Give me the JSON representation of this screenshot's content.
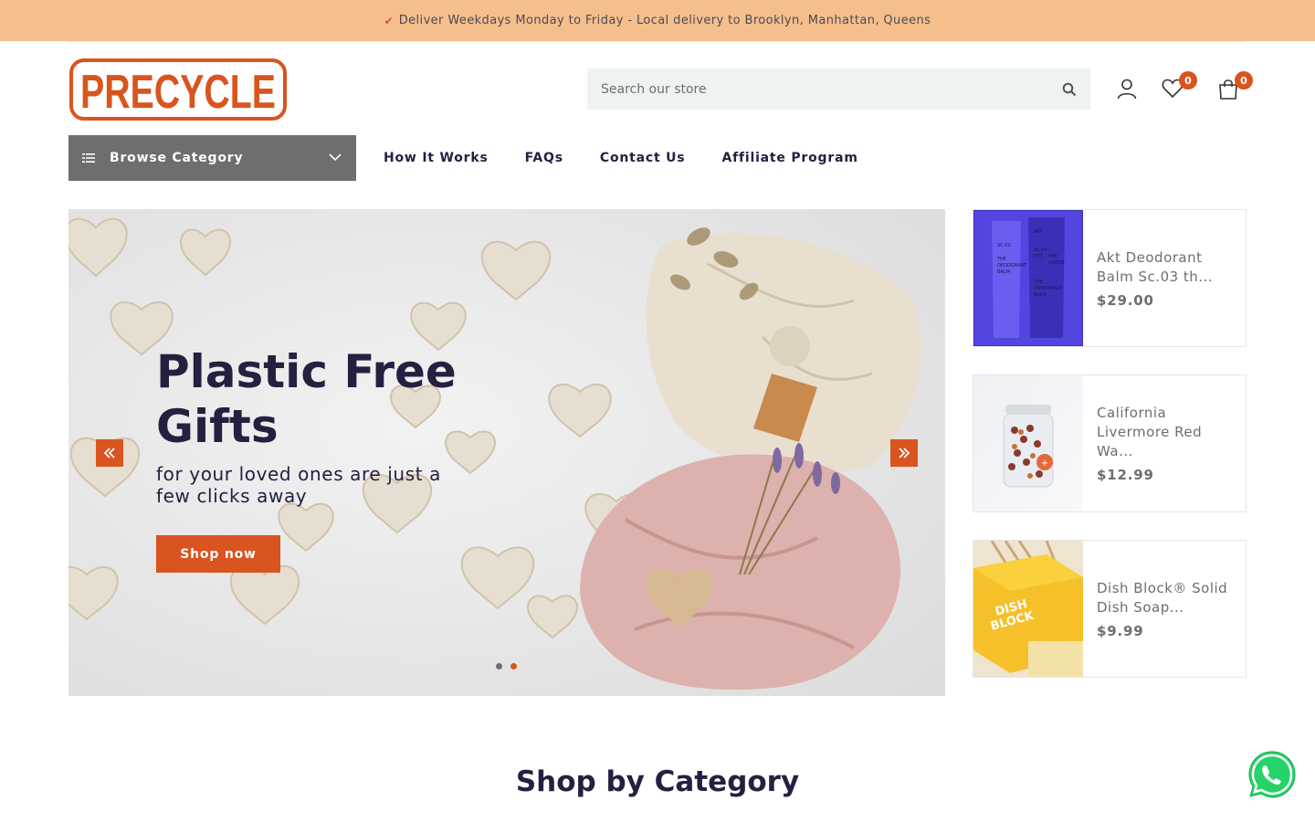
{
  "announcement": {
    "text": "Deliver Weekdays Monday to Friday - Local delivery to Brooklyn, Manhattan, Queens"
  },
  "header": {
    "logo_text": "PRECYCLE",
    "search_placeholder": "Search our store",
    "wishlist_count": "0",
    "cart_count": "0"
  },
  "nav": {
    "browse_label": "Browse Category",
    "links": [
      "How It Works",
      "FAQs",
      "Contact Us",
      "Affiliate Program"
    ]
  },
  "hero": {
    "title": "Plastic Free Gifts",
    "subtitle": "for your loved ones are just a few clicks away",
    "button": "Shop now",
    "slide_count": 2,
    "active_slide": 2
  },
  "products": [
    {
      "name": "Akt Deodorant Balm Sc.03 th...",
      "price": "$29.00"
    },
    {
      "name": "California Livermore Red Wa...",
      "price": "$12.99"
    },
    {
      "name": "Dish Block® Solid Dish Soap...",
      "price": "$9.99"
    }
  ],
  "sections": {
    "shop_by_category": "Shop by Category"
  },
  "colors": {
    "accent": "#d9541e",
    "topbar": "#f4bf8c",
    "navy": "#252040",
    "gray": "#6e6e6e"
  }
}
